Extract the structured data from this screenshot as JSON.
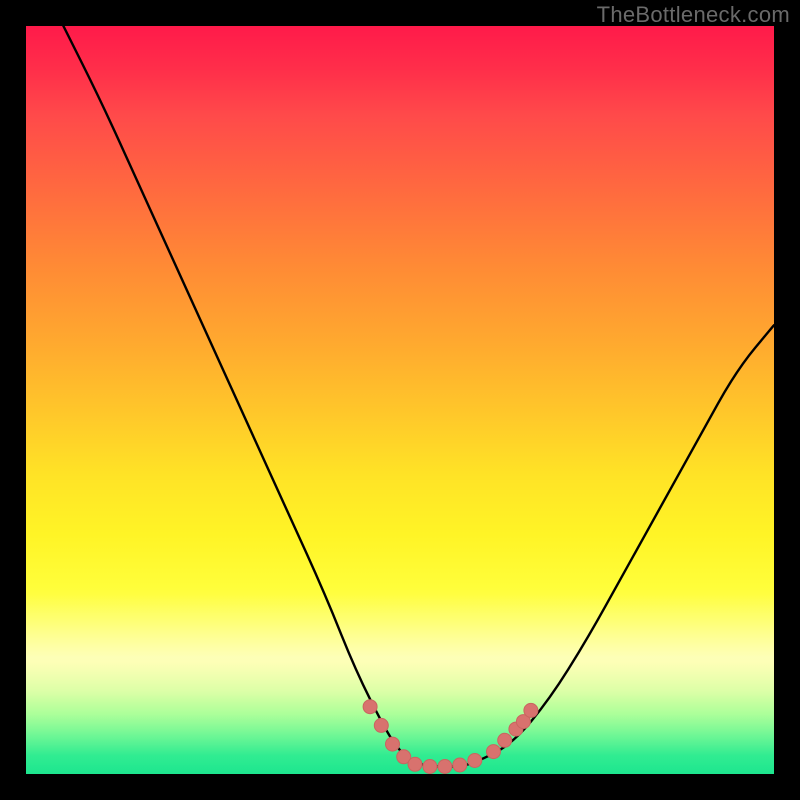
{
  "watermark": "TheBottleneck.com",
  "colors": {
    "frame": "#000000",
    "curve_stroke": "#000000",
    "marker_fill": "#d8726e",
    "marker_stroke": "#c96560"
  },
  "chart_data": {
    "type": "line",
    "title": "",
    "xlabel": "",
    "ylabel": "",
    "xlim": [
      0,
      100
    ],
    "ylim": [
      0,
      100
    ],
    "grid": false,
    "legend": false,
    "series": [
      {
        "name": "bottleneck-curve",
        "x": [
          5,
          10,
          15,
          20,
          25,
          30,
          35,
          40,
          44,
          48,
          50,
          52,
          54,
          56,
          58,
          60,
          65,
          70,
          75,
          80,
          85,
          90,
          95,
          100
        ],
        "values": [
          100,
          90,
          79,
          68,
          57,
          46,
          35,
          24,
          14,
          6,
          3,
          1.5,
          1,
          1,
          1,
          1.5,
          4,
          10,
          18,
          27,
          36,
          45,
          54,
          60
        ]
      }
    ],
    "markers": [
      {
        "x": 46.0,
        "y": 9.0
      },
      {
        "x": 47.5,
        "y": 6.5
      },
      {
        "x": 49.0,
        "y": 4.0
      },
      {
        "x": 50.5,
        "y": 2.3
      },
      {
        "x": 52.0,
        "y": 1.3
      },
      {
        "x": 54.0,
        "y": 1.0
      },
      {
        "x": 56.0,
        "y": 1.0
      },
      {
        "x": 58.0,
        "y": 1.2
      },
      {
        "x": 60.0,
        "y": 1.8
      },
      {
        "x": 62.5,
        "y": 3.0
      },
      {
        "x": 64.0,
        "y": 4.5
      },
      {
        "x": 65.5,
        "y": 6.0
      },
      {
        "x": 66.5,
        "y": 7.0
      },
      {
        "x": 67.5,
        "y": 8.5
      }
    ]
  }
}
